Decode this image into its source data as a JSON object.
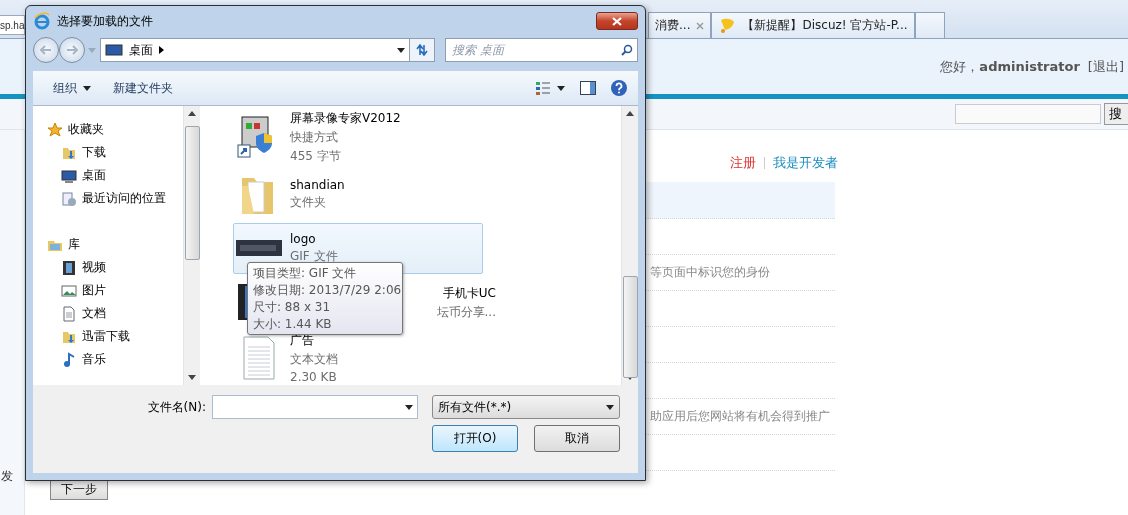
{
  "browser": {
    "address": "sp.ha",
    "tabs": [
      {
        "label": "消费...",
        "closable": true,
        "kind": "plain"
      },
      {
        "label": "【新提醒】Discuz! 官方站-P...",
        "closable": false,
        "kind": "notice"
      },
      {
        "kind": "empty"
      }
    ]
  },
  "header": {
    "greeting": "您好，",
    "user": "administrator",
    "logout": "[退出]"
  },
  "search": {
    "button": "搜"
  },
  "side_text": "发",
  "links": [
    {
      "label": "注册",
      "kind": "register"
    },
    {
      "label": "我是开发者",
      "kind": "developer"
    }
  ],
  "panel_rows": [
    {
      "kind": "head"
    },
    {
      "kind": "row"
    },
    {
      "text": "等页面中标识您的身份",
      "kind": "row"
    },
    {
      "kind": "row"
    },
    {
      "kind": "row"
    },
    {
      "kind": "row"
    },
    {
      "text": "助应用后您网站将有机会得到推广",
      "kind": "row"
    },
    {
      "kind": "row"
    }
  ],
  "next_button": "下一步",
  "dialog": {
    "title": "选择要加载的文件",
    "location": "桌面",
    "search_placeholder": "搜索 桌面",
    "toolbar": [
      {
        "label": "组织",
        "dropdown": true
      },
      {
        "label": "新建文件夹",
        "dropdown": false
      }
    ],
    "nav": [
      {
        "label": "收藏夹",
        "kind": "favorites",
        "children": [
          {
            "label": "下载",
            "kind": "download"
          },
          {
            "label": "桌面",
            "kind": "desktop"
          },
          {
            "label": "最近访问的位置",
            "kind": "recent"
          }
        ]
      },
      {
        "label": "库",
        "kind": "library",
        "children": [
          {
            "label": "视频",
            "kind": "video"
          },
          {
            "label": "图片",
            "kind": "image"
          },
          {
            "label": "文档",
            "kind": "document"
          },
          {
            "label": "迅雷下载",
            "kind": "download"
          },
          {
            "label": "音乐",
            "kind": "music"
          }
        ]
      }
    ],
    "files": [
      {
        "name": "屏幕录像专家V2012",
        "lines": [
          "快捷方式",
          "455 字节"
        ],
        "kind": "shortcut",
        "selected": false
      },
      {
        "name": "shandian",
        "lines": [
          "文件夹"
        ],
        "kind": "folder",
        "selected": false
      },
      {
        "name": "logo",
        "lines": [
          "GIF 文件"
        ],
        "kind": "thumbnail",
        "selected": true
      },
      {
        "name": "手机卡UC",
        "lines": [
          "坛币分享..."
        ],
        "kind": "video",
        "selected": false
      },
      {
        "name": "广告",
        "lines": [
          "文本文档",
          "2.30 KB"
        ],
        "kind": "text",
        "selected": false
      }
    ],
    "tooltip": [
      "项目类型: GIF 文件",
      "修改日期: 2013/7/29 2:06",
      "尺寸: 88 x 31",
      "大小: 1.44 KB"
    ],
    "filename_label": "文件名(N):",
    "filter": "所有文件(*.*)",
    "buttons": [
      {
        "label": "打开(O)",
        "default": true
      },
      {
        "label": "取消",
        "default": false
      }
    ]
  }
}
